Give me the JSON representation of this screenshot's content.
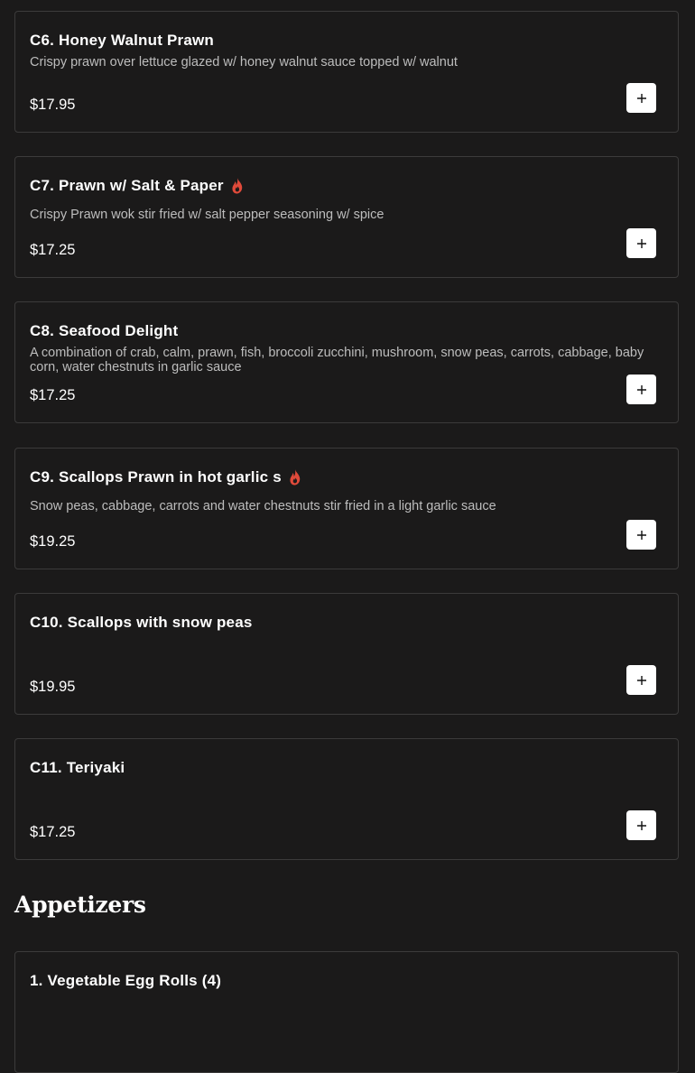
{
  "theme": {
    "background": "#1b1a1a",
    "card_border": "#3c3b3b",
    "spicy_color": "#e04a3a"
  },
  "items": [
    {
      "title": "C6. Honey Walnut Prawn",
      "description": "Crispy prawn over lettuce glazed w/ honey walnut sauce topped w/ walnut",
      "price": "$17.95",
      "spicy": false,
      "add_icon": "plus-icon"
    },
    {
      "title": "C7. Prawn w/ Salt & Paper",
      "description": "Crispy Prawn wok stir fried w/ salt pepper seasoning w/ spice",
      "price": "$17.25",
      "spicy": true,
      "add_icon": "plus-icon"
    },
    {
      "title": "C8. Seafood Delight",
      "description": "A combination of crab, calm, prawn, fish, broccoli zucchini, mushroom, snow peas, carrots, cabbage, baby corn, water chestnuts in garlic sauce",
      "price": "$17.25",
      "spicy": false,
      "add_icon": "plus-icon"
    },
    {
      "title": "C9. Scallops Prawn in hot garlic s",
      "description": "Snow peas, cabbage, carrots and water chestnuts stir fried in a light garlic sauce",
      "price": "$19.25",
      "spicy": true,
      "add_icon": "plus-icon"
    },
    {
      "title": "C10. Scallops with snow peas",
      "description": "",
      "price": "$19.95",
      "spicy": false,
      "add_icon": "plus-icon"
    },
    {
      "title": "C11. Teriyaki",
      "description": "",
      "price": "$17.25",
      "spicy": false,
      "add_icon": "plus-icon"
    }
  ],
  "sections": [
    {
      "title": "Appetizers"
    }
  ],
  "next_item": {
    "title": "1. Vegetable Egg Rolls (4)"
  }
}
